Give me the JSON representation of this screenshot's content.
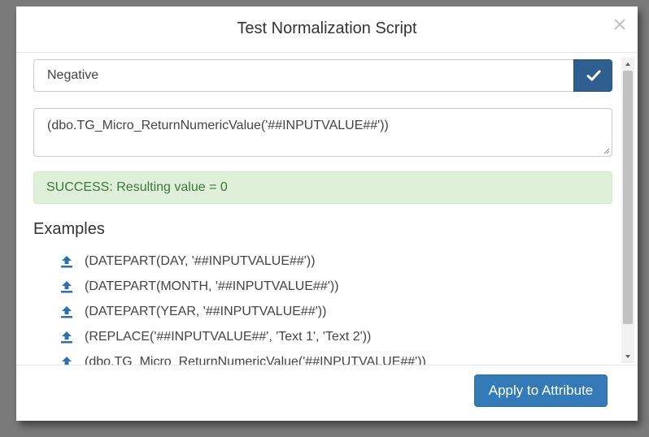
{
  "dialog": {
    "title": "Test Normalization Script",
    "close_icon": "close-icon"
  },
  "test_input": {
    "value": "Negative",
    "confirm_icon": "checkmark-icon"
  },
  "script": {
    "value": "(dbo.TG_Micro_ReturnNumericValue('##INPUTVALUE##'))"
  },
  "result": {
    "message": "SUCCESS: Resulting value = 0"
  },
  "examples": {
    "heading": "Examples",
    "icon": "upload-icon",
    "items": [
      "(DATEPART(DAY, '##INPUTVALUE##'))",
      "(DATEPART(MONTH, '##INPUTVALUE##'))",
      "(DATEPART(YEAR, '##INPUTVALUE##'))",
      "(REPLACE('##INPUTVALUE##', 'Text 1', 'Text 2'))",
      "(dbo.TG_Micro_ReturnNumericValue('##INPUTVALUE##'))"
    ]
  },
  "footer": {
    "apply_label": "Apply to Attribute"
  },
  "colors": {
    "primary": "#337ab7",
    "confirm": "#2f5f8f",
    "success_bg": "#dff0d8",
    "success_text": "#3c763d",
    "icon_blue": "#2f6fb0"
  }
}
